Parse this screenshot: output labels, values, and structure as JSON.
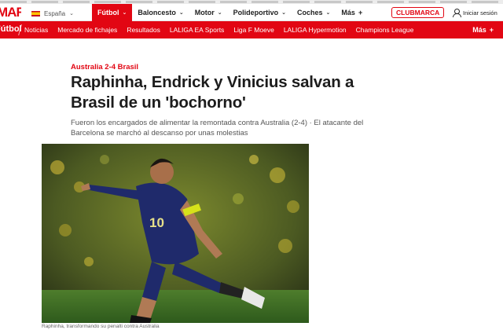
{
  "header": {
    "logo_text": "MARCA",
    "edition": "España",
    "nav": [
      {
        "label": "Fútbol",
        "active": true
      },
      {
        "label": "Baloncesto",
        "active": false
      },
      {
        "label": "Motor",
        "active": false
      },
      {
        "label": "Polideportivo",
        "active": false
      },
      {
        "label": "Coches",
        "active": false
      },
      {
        "label": "Más",
        "active": false
      }
    ],
    "club_label": "CLUBMARCA",
    "login_label": "Iniciar sesión"
  },
  "subnav": {
    "section": "Fútbol",
    "links": [
      "Noticias",
      "Mercado de fichajes",
      "Resultados",
      "LALIGA EA Sports",
      "Liga F Moeve",
      "LALIGA Hypermotion",
      "Champions League"
    ],
    "more_label": "Más"
  },
  "article": {
    "kicker": "Australia 2-4 Brasil",
    "headline": "Raphinha, Endrick y Vinicius salvan a Brasil de un 'bochorno'",
    "summary": "Fueron los encargados de alimentar la remontada contra Australia (2-4) · El atacante del Barcelona se marchó al descanso por unas molestias",
    "caption": "Raphinha, transformando su penalti contra Australia",
    "photo_player_number": "10"
  },
  "colors": {
    "brand": "#e20613",
    "kit": "#1f2a6b",
    "armband": "#d6e21a"
  }
}
